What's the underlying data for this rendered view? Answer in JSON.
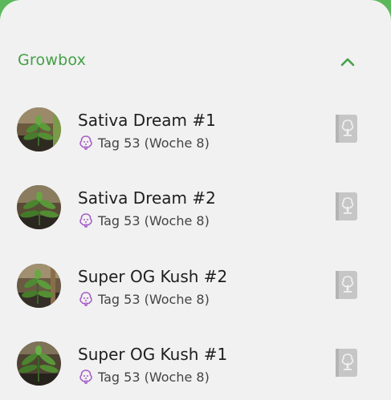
{
  "colors": {
    "accent": "#43a047",
    "age_icon": "#a45bc8",
    "diary_icon": "#c6c6c6",
    "background": "#f1f1f1"
  },
  "section": {
    "title": "Growbox",
    "collapse_icon": "chevron-up-icon"
  },
  "plants": [
    {
      "name": "Sativa Dream #1",
      "age": "Tag 53 (Woche 8)"
    },
    {
      "name": "Sativa Dream #2",
      "age": "Tag 53 (Woche 8)"
    },
    {
      "name": "Super OG Kush #2",
      "age": "Tag 53 (Woche 8)"
    },
    {
      "name": "Super OG Kush #1",
      "age": "Tag 53 (Woche 8)"
    }
  ],
  "icons": {
    "age": "plant-stage-icon",
    "diary": "plant-diary-icon",
    "avatar": "plant-photo"
  }
}
